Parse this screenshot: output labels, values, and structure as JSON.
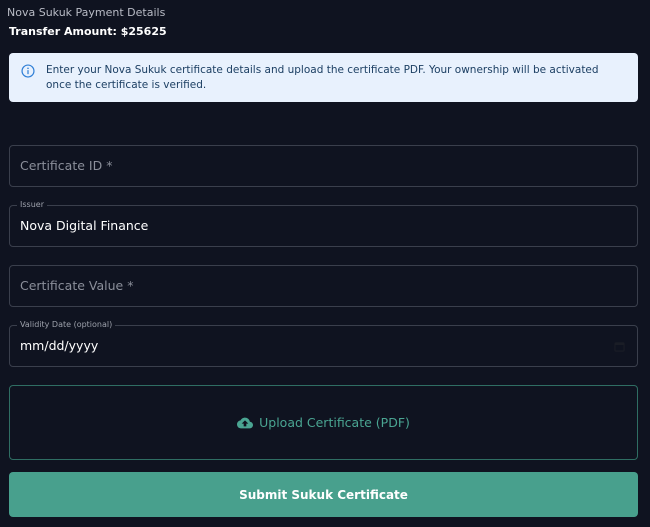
{
  "header": {
    "section_title": "Nova Sukuk Payment Details",
    "transfer_amount": "Transfer Amount: $25625"
  },
  "info_alert": {
    "icon": "info-icon",
    "text": "Enter your Nova Sukuk certificate details and upload the certificate PDF. Your ownership will be activated once the certificate is verified."
  },
  "form": {
    "certificate_id": {
      "placeholder": "Certificate ID *",
      "value": ""
    },
    "issuer": {
      "label": "Issuer",
      "value": "Nova Digital Finance"
    },
    "certificate_value": {
      "placeholder": "Certificate Value *",
      "value": ""
    },
    "validity_date": {
      "label": "Validity Date (optional)",
      "value": "mm/dd/yyyy",
      "icon": "calendar-icon"
    }
  },
  "upload": {
    "icon": "cloud-upload-icon",
    "label": "Upload Certificate (PDF)"
  },
  "submit": {
    "label": "Submit Sukuk Certificate"
  },
  "colors": {
    "background": "#0f1320",
    "alert_background": "#e8f1fd",
    "accent": "#48a08d",
    "field_border": "#3a3f4c"
  }
}
